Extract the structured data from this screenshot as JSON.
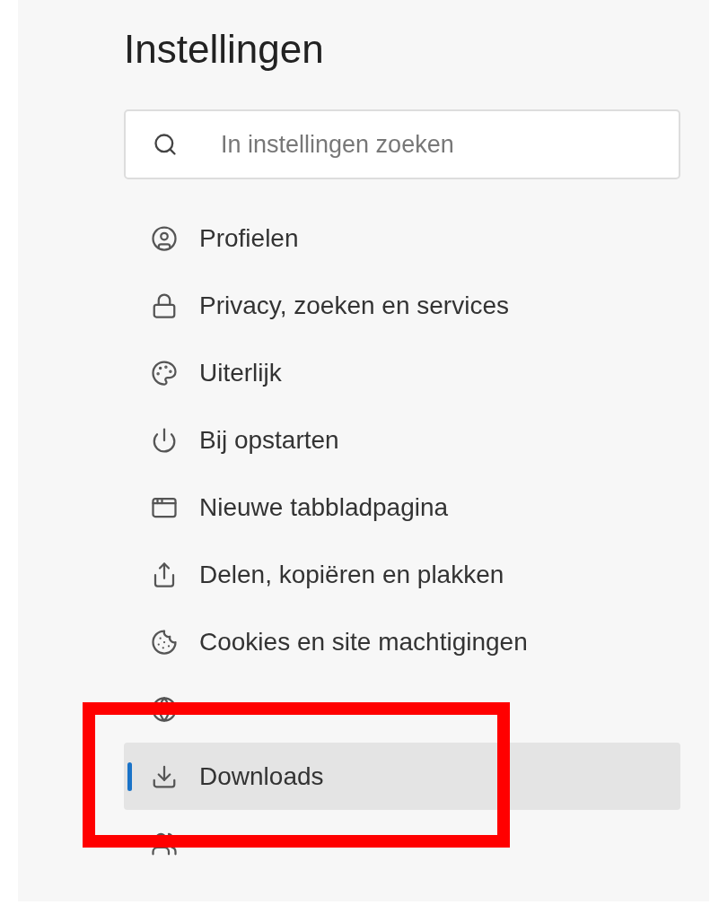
{
  "title": "Instellingen",
  "search": {
    "placeholder": "In instellingen zoeken"
  },
  "nav": [
    {
      "label": "Profielen",
      "selected": false
    },
    {
      "label": "Privacy, zoeken en services",
      "selected": false
    },
    {
      "label": "Uiterlijk",
      "selected": false
    },
    {
      "label": "Bij opstarten",
      "selected": false
    },
    {
      "label": "Nieuwe tabbladpagina",
      "selected": false
    },
    {
      "label": "Delen, kopiëren en plakken",
      "selected": false
    },
    {
      "label": "Cookies en site machtigingen",
      "selected": false
    },
    {
      "selected": false
    },
    {
      "label": "Downloads",
      "selected": true
    },
    {
      "selected": false
    }
  ],
  "annotation": {
    "kind": "highlight-box",
    "color": "#ff0000"
  }
}
